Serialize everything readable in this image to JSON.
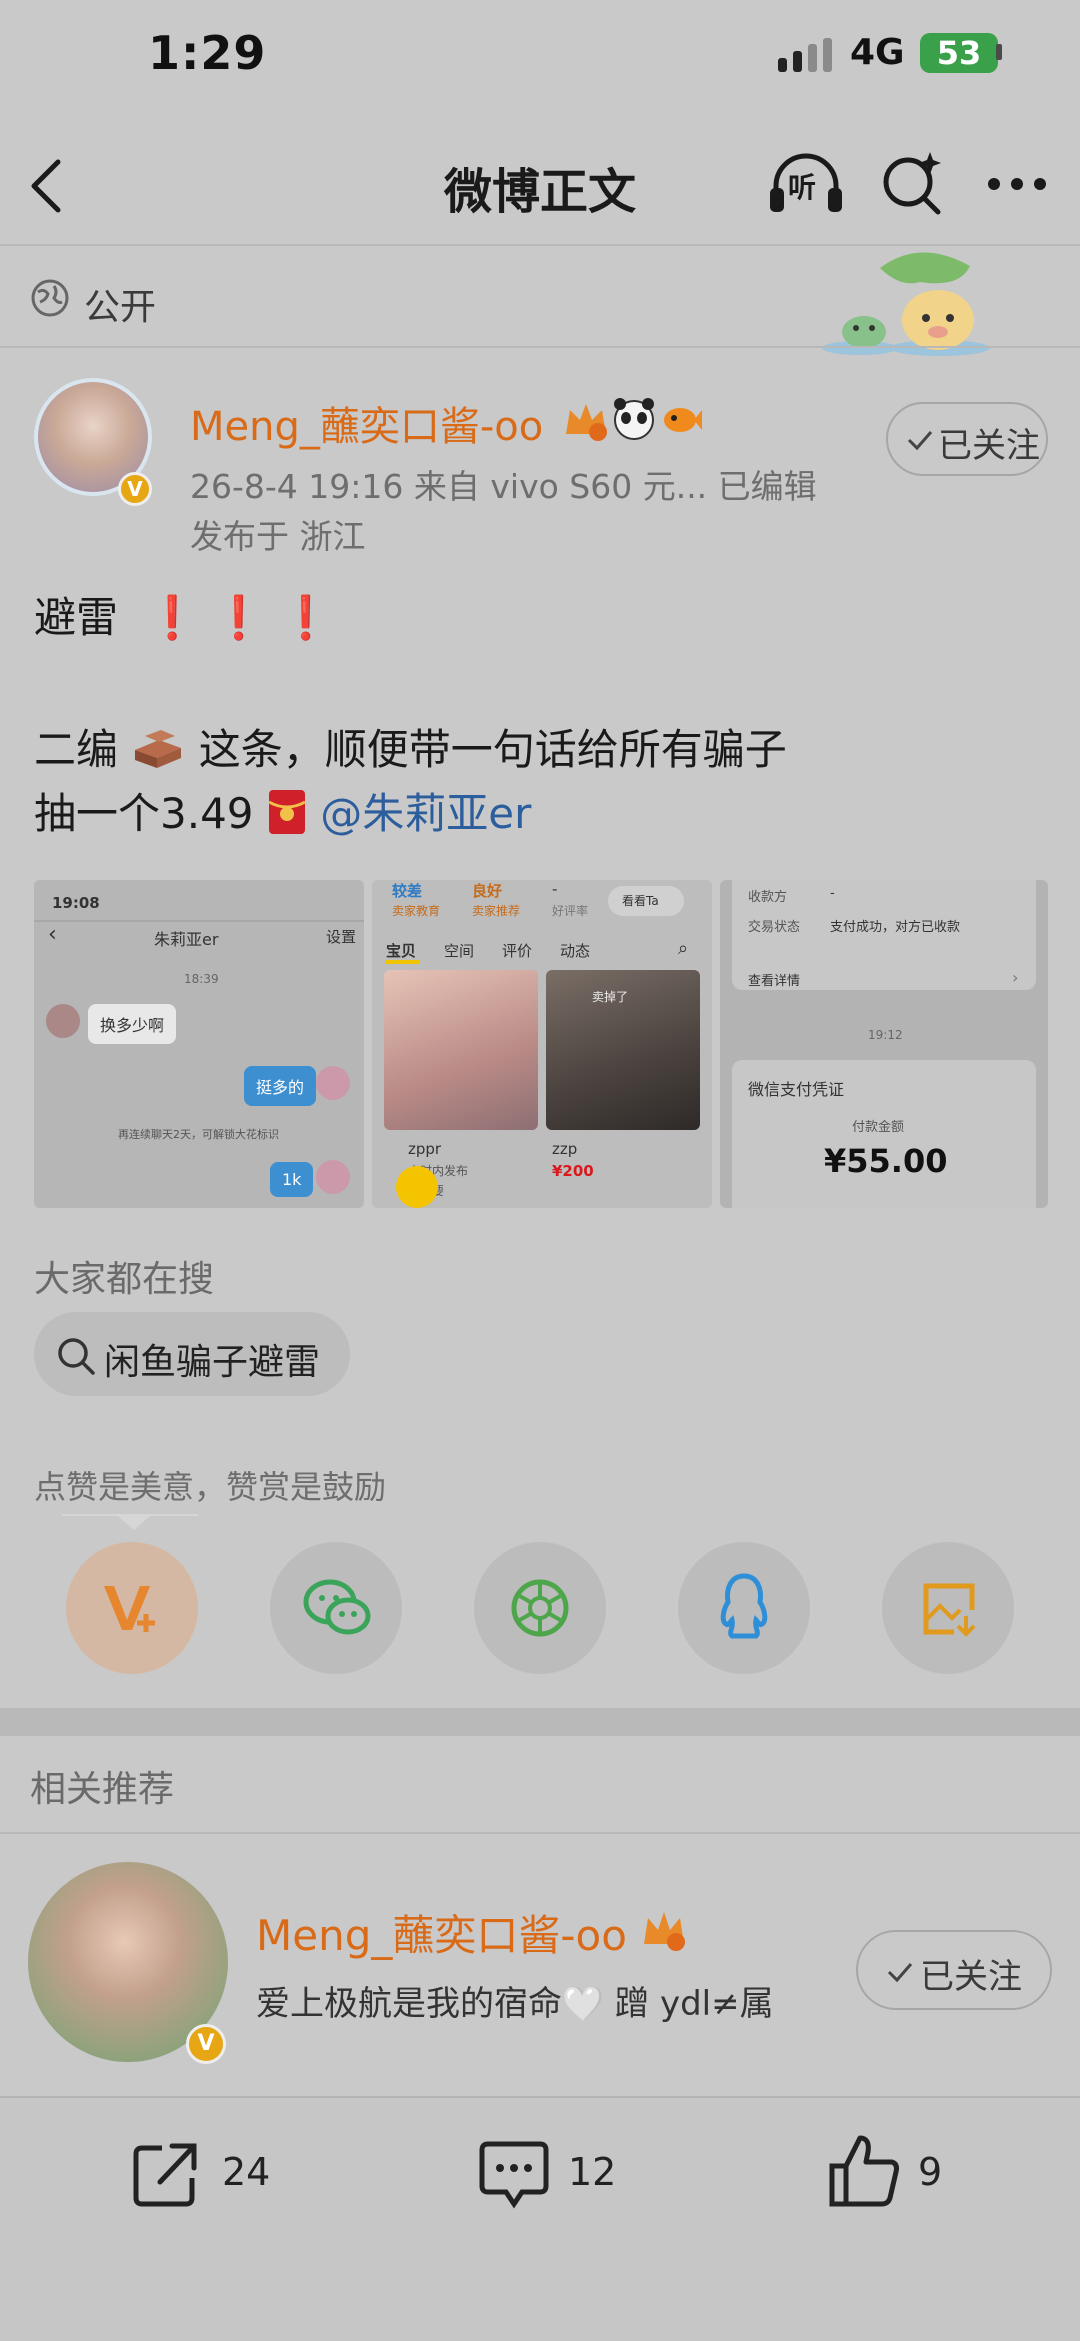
{
  "status_bar": {
    "time": "1:29",
    "network": "4G",
    "battery": "53"
  },
  "nav": {
    "title": "微博正文",
    "listen_label": "听"
  },
  "visibility": {
    "label": "公开"
  },
  "author": {
    "name": "Meng_蘸奕口酱-oo",
    "meta": "26-8-4 19:16  来自 vivo S60 元...  已编辑",
    "location": "发布于 浙江",
    "follow_label": "已关注",
    "verified_badge": "V"
  },
  "post": {
    "line1": "避雷",
    "line2": "二编",
    "line2_rest": "这条，顺便带一句话给所有骗子",
    "line3": "抽一个3.49",
    "mention": "@朱莉亚er"
  },
  "images": {
    "img1": {
      "time": "19:08",
      "contact": "朱莉亚er",
      "settings": "设置",
      "stamp": "18:39",
      "msg1": "换多少啊",
      "msg2": "挺多的",
      "notice": "再连续聊天2天，可解锁大花标识",
      "msg3": "1k"
    },
    "img2": {
      "stat1_a": "较差",
      "stat1_b": "卖家教育",
      "stat2_a": "良好",
      "stat2_b": "卖家推荐",
      "stat3_a": "-",
      "stat3_b": "好评率",
      "see_ta": "看看Ta",
      "tabs": [
        "宝贝",
        "空间",
        "评价",
        "动态"
      ],
      "item1_label": "zppr",
      "item1_meta": "小时内发布",
      "item1_meta2": "人想要",
      "item2_label": "zzp",
      "item2_price": "¥200",
      "photo_tag": "卖掉了"
    },
    "img3": {
      "payee_label": "收款方",
      "payee_value": "-",
      "status_label": "交易状态",
      "status_value": "支付成功，对方已收款",
      "detail_link": "查看详情",
      "stamp": "19:12",
      "voucher_title": "微信支付凭证",
      "amount_label": "付款金额",
      "amount_value": "¥55.00"
    }
  },
  "trending": {
    "title": "大家都在搜",
    "query": "闲鱼骗子避雷"
  },
  "praise": {
    "label": "点赞是美意，赞赏是鼓励"
  },
  "share_targets": [
    {
      "name": "reward",
      "icon": "v-plus-icon",
      "color": "#e6862e"
    },
    {
      "name": "wechat",
      "icon": "wechat-icon",
      "color": "#3aa55a"
    },
    {
      "name": "moments",
      "icon": "moments-icon",
      "color": "#4ea64a"
    },
    {
      "name": "qq",
      "icon": "qq-icon",
      "color": "#2e8fd8"
    },
    {
      "name": "save-image",
      "icon": "save-image-icon",
      "color": "#e09a1e"
    }
  ],
  "related": {
    "title": "相关推荐",
    "user_name": "Meng_蘸奕口酱-oo",
    "user_desc": "爱上极航是我的宿命🤍  蹭 ydl≠属",
    "follow_label": "已关注"
  },
  "actions": {
    "repost_count": "24",
    "comment_count": "12",
    "like_count": "9"
  },
  "colors": {
    "accent_orange": "#d86a18",
    "link_blue": "#2c5d9c",
    "battery_green": "#3aa14a"
  }
}
